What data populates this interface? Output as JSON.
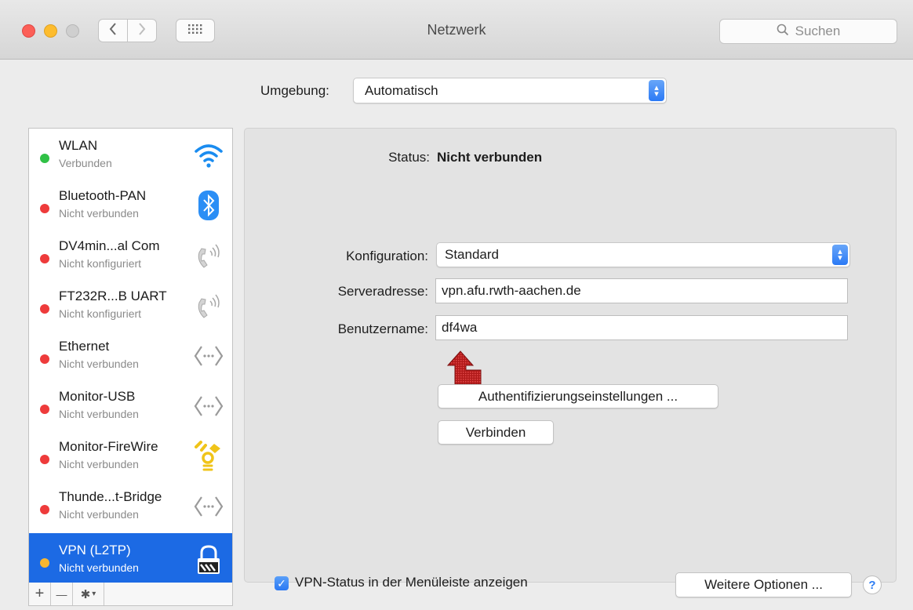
{
  "window": {
    "title": "Netzwerk",
    "search_placeholder": "Suchen"
  },
  "location": {
    "label": "Umgebung:",
    "value": "Automatisch"
  },
  "services": [
    {
      "name": "WLAN",
      "status": "Verbunden",
      "status_color": "#30c146",
      "icon": "wifi-icon"
    },
    {
      "name": "Bluetooth-PAN",
      "status": "Nicht verbunden",
      "status_color": "#ee3b3b",
      "icon": "bluetooth-icon"
    },
    {
      "name": "DV4min...al Com",
      "status": "Nicht konfiguriert",
      "status_color": "#ee3b3b",
      "icon": "phone-icon"
    },
    {
      "name": "FT232R...B UART",
      "status": "Nicht konfiguriert",
      "status_color": "#ee3b3b",
      "icon": "phone-icon"
    },
    {
      "name": "Ethernet",
      "status": "Nicht verbunden",
      "status_color": "#ee3b3b",
      "icon": "ethernet-icon"
    },
    {
      "name": "Monitor-USB",
      "status": "Nicht verbunden",
      "status_color": "#ee3b3b",
      "icon": "ethernet-icon"
    },
    {
      "name": "Monitor-FireWire",
      "status": "Nicht verbunden",
      "status_color": "#ee3b3b",
      "icon": "firewire-icon"
    },
    {
      "name": "Thunde...t-Bridge",
      "status": "Nicht verbunden",
      "status_color": "#ee3b3b",
      "icon": "ethernet-icon"
    },
    {
      "name": "VPN (L2TP)",
      "status": "Nicht verbunden",
      "status_color": "#f7b731",
      "icon": "vpn-lock-icon",
      "selected": true
    }
  ],
  "sidebar_toolbar": {
    "add": "+",
    "remove": "—",
    "action": "✱"
  },
  "detail": {
    "status_label": "Status:",
    "status_value": "Nicht verbunden",
    "config_label": "Konfiguration:",
    "config_value": "Standard",
    "server_label": "Serveradresse:",
    "server_value": "vpn.afu.rwth-aachen.de",
    "user_label": "Benutzername:",
    "user_value": "df4wa",
    "auth_button": "Authentifizierungseinstellungen ...",
    "connect_button": "Verbinden",
    "show_status_label": "VPN-Status in der Menüleiste anzeigen",
    "show_status_checked": true,
    "more_options_button": "Weitere Optionen ...",
    "help": "?"
  }
}
